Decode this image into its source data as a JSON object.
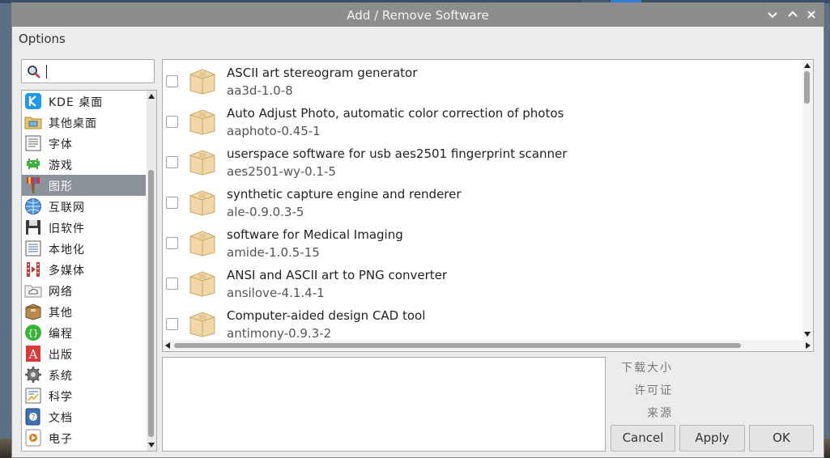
{
  "window": {
    "title": "Add / Remove Software"
  },
  "menubar": {
    "options": "Options"
  },
  "search": {
    "value": "",
    "placeholder": ""
  },
  "categories": [
    {
      "label": "KDE 桌面",
      "icon": "kde-icon"
    },
    {
      "label": "其他桌面",
      "icon": "folder-desktop-icon"
    },
    {
      "label": "字体",
      "icon": "font-icon"
    },
    {
      "label": "游戏",
      "icon": "game-invader-icon"
    },
    {
      "label": "图形",
      "icon": "paintbrush-icon",
      "selected": true
    },
    {
      "label": "互联网",
      "icon": "globe-icon"
    },
    {
      "label": "旧软件",
      "icon": "floppy-icon"
    },
    {
      "label": "本地化",
      "icon": "document-lines-icon"
    },
    {
      "label": "多媒体",
      "icon": "film-icon"
    },
    {
      "label": "网络",
      "icon": "cloud-folder-icon"
    },
    {
      "label": "其他",
      "icon": "box-icon"
    },
    {
      "label": "编程",
      "icon": "code-braces-icon"
    },
    {
      "label": "出版",
      "icon": "publisher-a-icon"
    },
    {
      "label": "系统",
      "icon": "gear-icon"
    },
    {
      "label": "科学",
      "icon": "chart-doc-icon"
    },
    {
      "label": "文档",
      "icon": "help-book-icon"
    },
    {
      "label": "电子",
      "icon": "electronics-icon"
    }
  ],
  "packages": [
    {
      "description": "ASCII art stereogram generator",
      "name": "aa3d-1.0-8",
      "checked": false
    },
    {
      "description": "Auto Adjust Photo, automatic color correction of photos",
      "name": "aaphoto-0.45-1",
      "checked": false
    },
    {
      "description": "userspace software for usb aes2501 fingerprint scanner",
      "name": "aes2501-wy-0.1-5",
      "checked": false
    },
    {
      "description": "synthetic capture engine and renderer",
      "name": "ale-0.9.0.3-5",
      "checked": false
    },
    {
      "description": "software for Medical Imaging",
      "name": "amide-1.0.5-15",
      "checked": false
    },
    {
      "description": "ANSI and ASCII art to PNG converter",
      "name": "ansilove-4.1.4-1",
      "checked": false
    },
    {
      "description": "Computer-aided design CAD tool",
      "name": "antimony-0.9.3-2",
      "checked": false
    }
  ],
  "info": {
    "download_size": "下载大小",
    "license": "许可证",
    "source": "来源"
  },
  "buttons": {
    "cancel": "Cancel",
    "apply": "Apply",
    "ok": "OK"
  },
  "colors": {
    "titlebar": "#8d8d8d",
    "selection": "#8c929a",
    "window_bg": "#ececec"
  }
}
